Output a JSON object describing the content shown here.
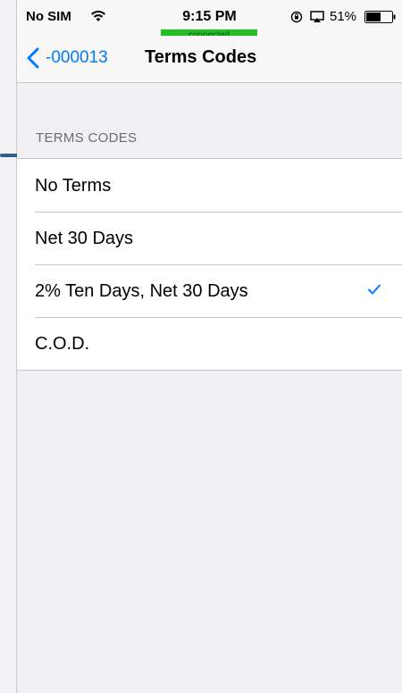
{
  "status_bar": {
    "carrier": "No SIM",
    "time": "9:15 PM",
    "connection_badge": "connected",
    "battery": "51%",
    "icons": [
      "wifi-icon",
      "rotation-lock-icon",
      "airplay-icon",
      "battery-icon"
    ]
  },
  "nav": {
    "back_label": "-000013",
    "title": "Terms Codes",
    "accent_color": "#007aff"
  },
  "section": {
    "header": "TERMS CODES",
    "items": [
      {
        "label": "No Terms",
        "selected": false
      },
      {
        "label": "Net 30 Days",
        "selected": false
      },
      {
        "label": "2% Ten Days, Net 30 Days",
        "selected": true
      },
      {
        "label": "C.O.D.",
        "selected": false
      }
    ]
  }
}
